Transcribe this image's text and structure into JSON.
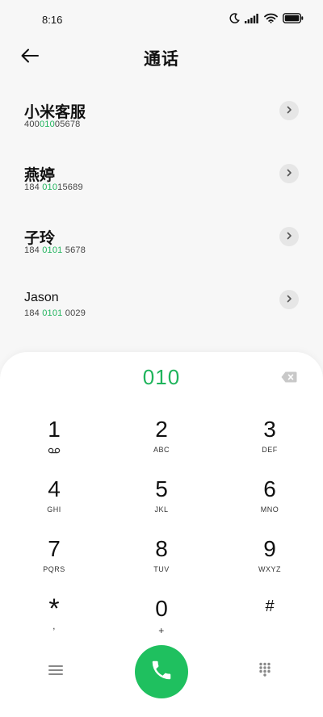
{
  "status_bar": {
    "time": "8:16"
  },
  "header": {
    "title": "通话"
  },
  "contacts": [
    {
      "name": "小米客服",
      "number_pre": "400",
      "number_match": "010",
      "number_post": "05678"
    },
    {
      "name": "燕婷",
      "number_pre": "184 ",
      "number_match": "010",
      "number_post": "15689"
    },
    {
      "name": "子玲",
      "number_pre": "184 ",
      "number_match": "0101",
      "number_post": " 5678"
    },
    {
      "name": "Jason",
      "number_pre": "184 ",
      "number_match": "0101",
      "number_post": " 0029"
    }
  ],
  "dialer": {
    "input": "010",
    "keys": [
      {
        "digit": "1",
        "letters": ""
      },
      {
        "digit": "2",
        "letters": "ABC"
      },
      {
        "digit": "3",
        "letters": "DEF"
      },
      {
        "digit": "4",
        "letters": "GHI"
      },
      {
        "digit": "5",
        "letters": "JKL"
      },
      {
        "digit": "6",
        "letters": "MNO"
      },
      {
        "digit": "7",
        "letters": "PQRS"
      },
      {
        "digit": "8",
        "letters": "TUV"
      },
      {
        "digit": "9",
        "letters": "WXYZ"
      },
      {
        "digit": "*",
        "letters": ","
      },
      {
        "digit": "0",
        "letters": "+"
      },
      {
        "digit": "#",
        "letters": ""
      }
    ]
  },
  "colors": {
    "accent": "#1fb45c",
    "call_button": "#1fc05f",
    "background": "#f7f7f7"
  },
  "icons": {
    "back": "arrow-left-icon",
    "voicemail": "voicemail-icon",
    "backspace": "backspace-icon",
    "menu": "menu-icon",
    "call": "phone-icon",
    "dialpad": "dialpad-icon"
  }
}
